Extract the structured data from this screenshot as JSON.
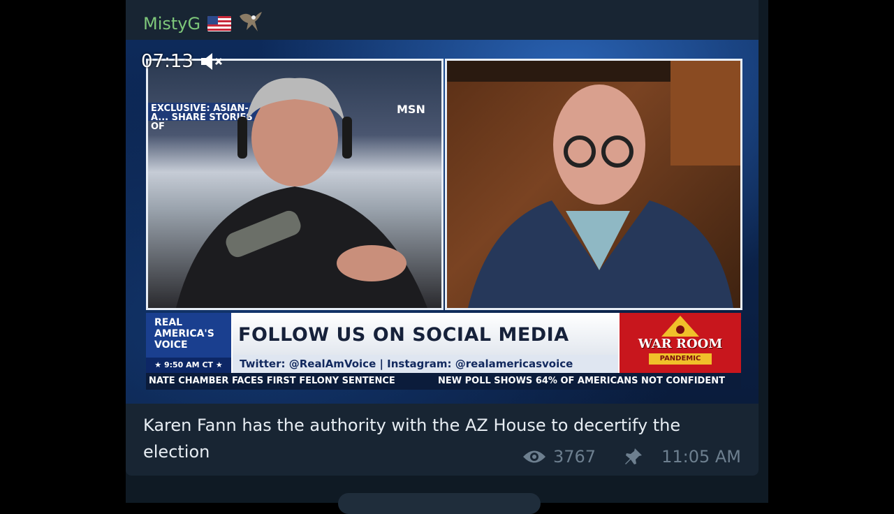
{
  "message": {
    "sender": "MistyG",
    "sender_badges": [
      "flag-us-icon",
      "eagle-icon"
    ],
    "caption": "Karen Fann has the authority with the AZ House to decertify the election",
    "views": "3767",
    "time": "11:05 AM"
  },
  "video": {
    "timecode": "07:13",
    "muted": true,
    "left_panel_top_text": "EXCLUSIVE: ASIAN-A... SHARE STORIES OF",
    "left_panel_network": "MSN",
    "brand": "REAL AMERICA'S VOICE",
    "brand_time": "★ 9:50 AM CT ★",
    "headline": "FOLLOW US ON SOCIAL MEDIA",
    "subline": "Twitter: @RealAmVoice | Instagram: @realamericasvoice",
    "show_title": "WAR ROOM",
    "show_sub": "PANDEMIC",
    "ticker_left": "NATE CHAMBER FACES FIRST FELONY SENTENCE",
    "ticker_right": "NEW POLL SHOWS 64% OF AMERICANS NOT CONFIDENT"
  },
  "colors": {
    "sender_name": "#7ec77a",
    "message_bg": "#182533",
    "meta_text": "#6d7f8f"
  }
}
